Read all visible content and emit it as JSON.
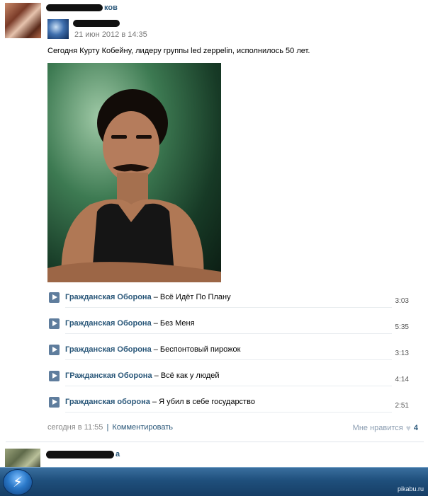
{
  "post": {
    "author_visible": "ков",
    "repost": {
      "date": "21 июн 2012 в 14:35"
    },
    "text": "Сегодня Курту Кобейну, лидеру группы led zeppelin, исполнилось 50 лет."
  },
  "tracks": [
    {
      "artist": "Гражданская Оборона",
      "dash": " – ",
      "title": "Всё Идёт По Плану",
      "duration": "3:03"
    },
    {
      "artist": "Гражданская Оборона",
      "dash": " – ",
      "title": "Без Меня",
      "duration": "5:35"
    },
    {
      "artist": "Гражданская Оборона",
      "dash": " – ",
      "title": "Беспонтовый пирожок",
      "duration": "3:13"
    },
    {
      "artist": "ГРажданская Оборона",
      "dash": " – ",
      "title": "Всё как у людей",
      "duration": "4:14"
    },
    {
      "artist": "Гражданская оборона",
      "dash": " – ",
      "title": "Я убил в себе государство",
      "duration": "2:51"
    }
  ],
  "footer": {
    "time": "сегодня в 11:55",
    "separator": "|",
    "comment_label": "Комментировать",
    "like_label": "Мне нравится",
    "like_icon": "heart-icon",
    "like_count": "4"
  },
  "second_post": {
    "author_visible": "а"
  },
  "watermark": "pikabu.ru",
  "colors": {
    "link": "#2b587a",
    "taskbar": "#1f4f7c"
  }
}
